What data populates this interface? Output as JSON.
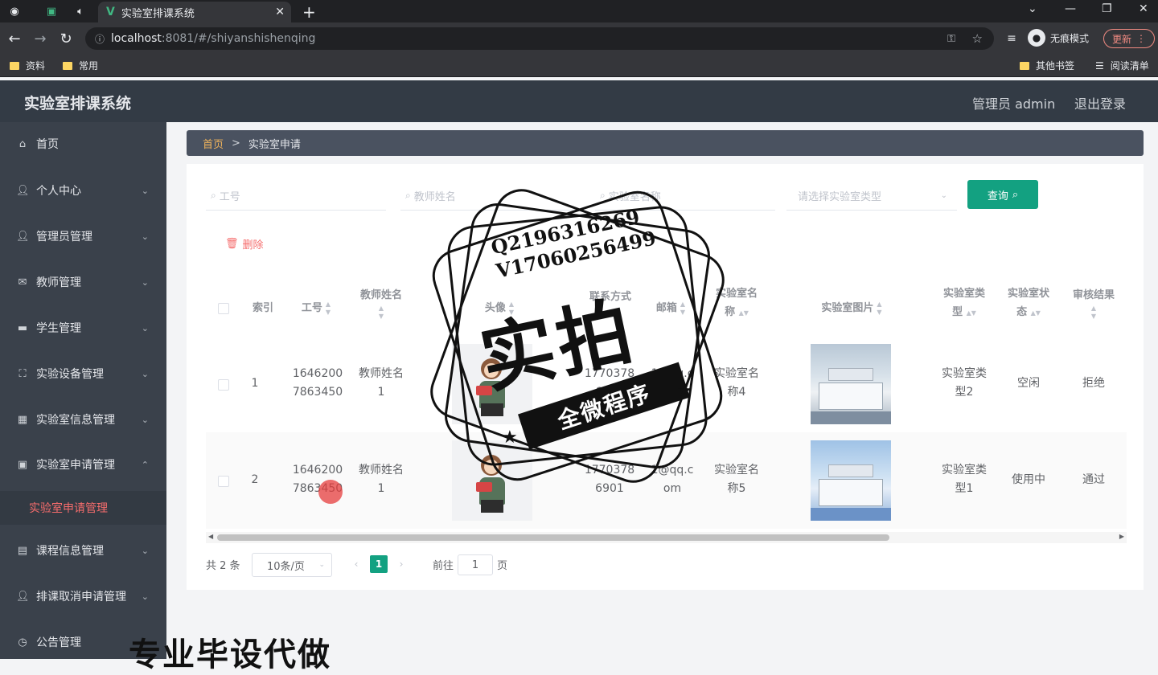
{
  "browser": {
    "tab_title": "实验室排课系统",
    "url_host": "localhost",
    "url_path": ":8081/#/shiyanshishenqing",
    "incognito_label": "无痕模式",
    "update_label": "更新",
    "bookmarks": [
      "资料",
      "常用"
    ],
    "bookmarks_right": [
      "其他书签",
      "阅读清单"
    ]
  },
  "header": {
    "title": "实验室排课系统",
    "admin_label": "管理员 admin",
    "logout_label": "退出登录"
  },
  "sidebar": {
    "items": [
      {
        "label": "首页",
        "icon": "home-icon"
      },
      {
        "label": "个人中心",
        "icon": "user-icon"
      },
      {
        "label": "管理员管理",
        "icon": "user-icon"
      },
      {
        "label": "教师管理",
        "icon": "mail-icon"
      },
      {
        "label": "学生管理",
        "icon": "briefcase-icon"
      },
      {
        "label": "实验设备管理",
        "icon": "scan-icon"
      },
      {
        "label": "实验室信息管理",
        "icon": "grid-icon"
      },
      {
        "label": "实验室申请管理",
        "icon": "calendar-icon"
      },
      {
        "label": "课程信息管理",
        "icon": "list-icon"
      },
      {
        "label": "排课取消申请管理",
        "icon": "user-icon"
      },
      {
        "label": "公告管理",
        "icon": "clock-icon"
      }
    ],
    "active_sub": "实验室申请管理"
  },
  "breadcrumb": {
    "home": "首页",
    "sep": ">",
    "current": "实验室申请"
  },
  "search": {
    "placeholder_gonghao": "工号",
    "placeholder_teacher": "教师姓名",
    "placeholder_lab": "实验室名称",
    "placeholder_type": "请选择实验室类型",
    "query_label": "查询"
  },
  "actions": {
    "delete_label": "删除"
  },
  "table": {
    "headers": {
      "index": "索引",
      "gonghao": "工号",
      "teacher": "教师姓名",
      "avatar": "头像",
      "contact": "联系方式",
      "email": "邮箱",
      "labname_1": "实验室名",
      "labname_2": "称",
      "labimg": "实验室图片",
      "labtype_1": "实验室类",
      "labtype_2": "型",
      "labstatus_1": "实验室状",
      "labstatus_2": "态",
      "result": "审核结果"
    },
    "rows": [
      {
        "index": "1",
        "gonghao_1": "1646200",
        "gonghao_2": "7863450",
        "teacher_1": "教师姓名",
        "teacher_2": "1",
        "contact_1": "1770378",
        "contact_2": "6901",
        "email_1": "1@qq.c",
        "email_2": "om",
        "labname_1": "实验室名",
        "labname_2": "称4",
        "labtype_1": "实验室类",
        "labtype_2": "型2",
        "status": "空闲",
        "result": "拒绝"
      },
      {
        "index": "2",
        "gonghao_1": "1646200",
        "gonghao_2": "7863450",
        "teacher_1": "教师姓名",
        "teacher_2": "1",
        "contact_1": "1770378",
        "contact_2": "6901",
        "email_1": "1@qq.c",
        "email_2": "om",
        "labname_1": "实验室名",
        "labname_2": "称5",
        "labtype_1": "实验室类",
        "labtype_2": "型1",
        "status": "使用中",
        "result": "通过"
      }
    ]
  },
  "pagination": {
    "total": "共 2 条",
    "page_size": "10条/页",
    "current_page": "1",
    "goto_label": "前往",
    "goto_value": "1",
    "page_word": "页"
  },
  "watermark": {
    "qq_line": "Q2196316269",
    "v_line": "V17060256499",
    "big_text": "实拍",
    "banner": "全微程序",
    "bottom_text": "专业毕设代做"
  }
}
